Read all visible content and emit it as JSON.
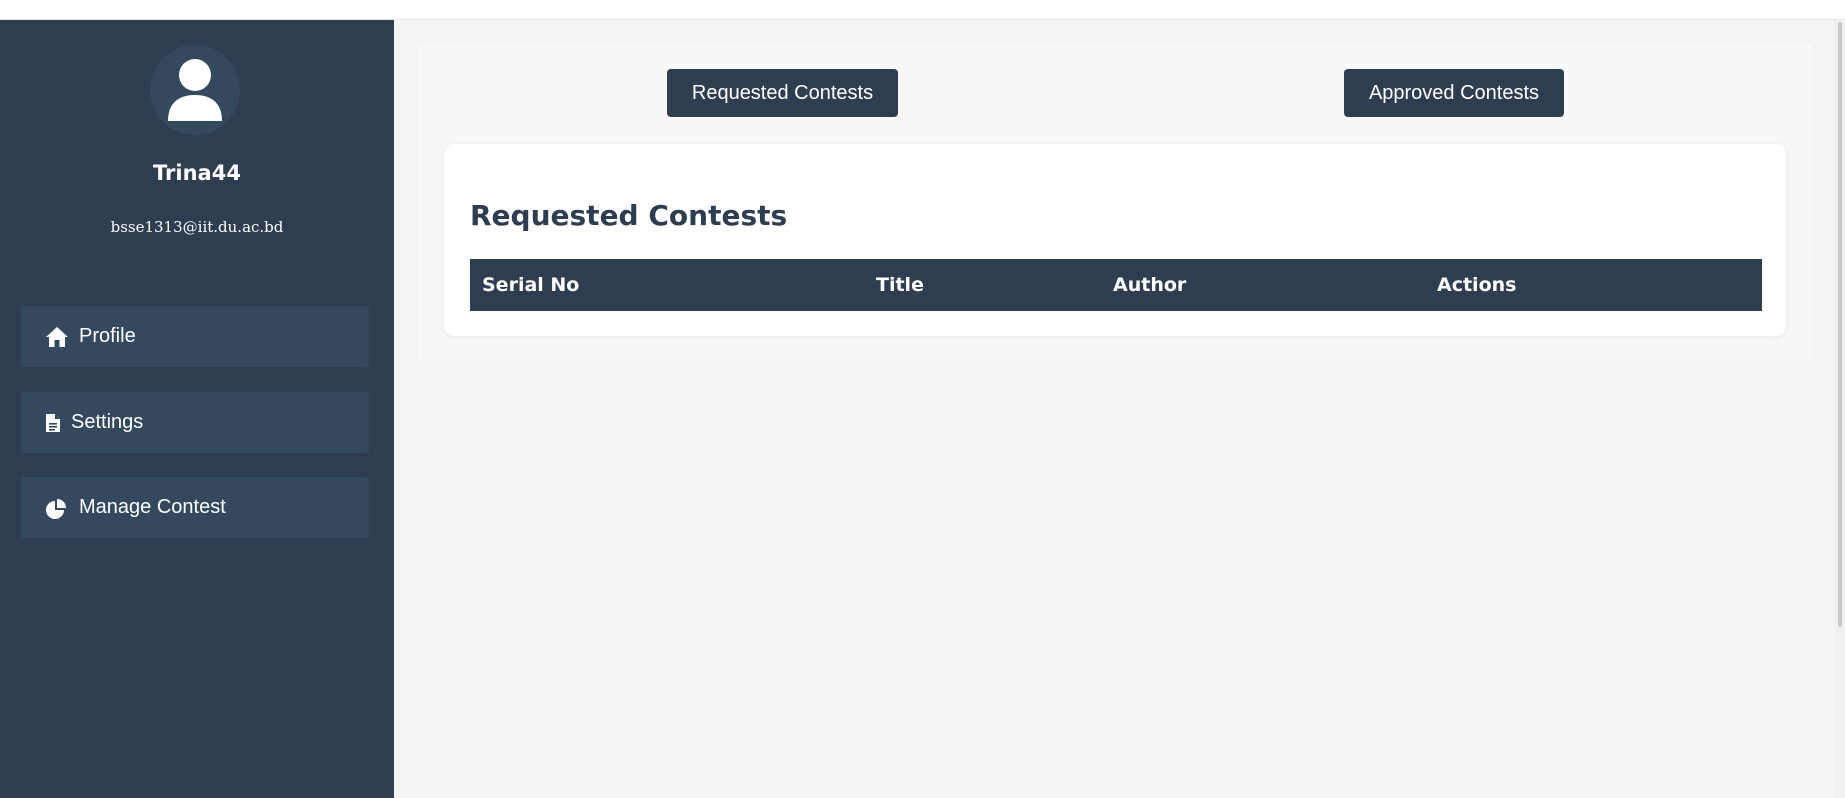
{
  "user": {
    "avatar_icon": "user-icon",
    "name": "Trina44",
    "email": "bsse1313@iit.du.ac.bd"
  },
  "sidebar": {
    "items": [
      {
        "label": "Profile",
        "icon": "home-icon"
      },
      {
        "label": "Settings",
        "icon": "document-icon"
      },
      {
        "label": "Manage Contest",
        "icon": "pie-chart-icon"
      }
    ]
  },
  "tabs": {
    "requested_label": "Requested Contests",
    "approved_label": "Approved Contests"
  },
  "card": {
    "title": "Requested Contests",
    "columns": [
      "Serial No",
      "Title",
      "Author",
      "Actions"
    ],
    "rows": []
  },
  "colors": {
    "sidebar_bg": "#2e3e50",
    "nav_item_bg": "#34495e",
    "accent_text": "#2e3e50",
    "main_bg": "#f4f4f4"
  }
}
